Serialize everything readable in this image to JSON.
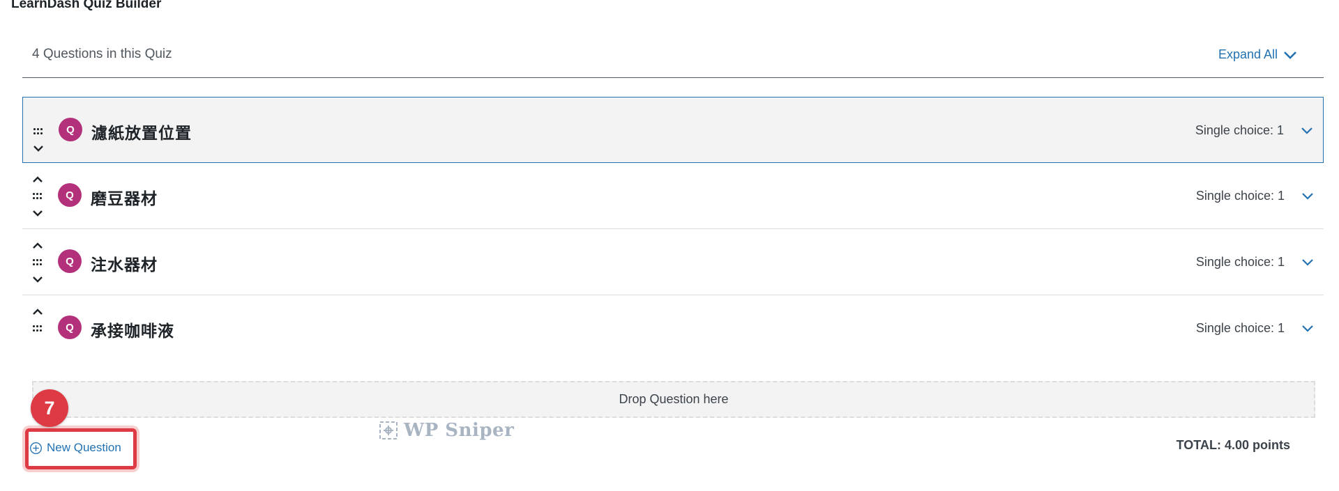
{
  "page_title": "LearnDash Quiz Builder",
  "header": {
    "question_count": "4 Questions in this Quiz",
    "expand_all_label": "Expand All"
  },
  "questions": [
    {
      "badge": "Q",
      "title": "濾紙放置位置",
      "type": "Single choice: 1"
    },
    {
      "badge": "Q",
      "title": "磨豆器材",
      "type": "Single choice: 1"
    },
    {
      "badge": "Q",
      "title": "注水器材",
      "type": "Single choice: 1"
    },
    {
      "badge": "Q",
      "title": "承接咖啡液",
      "type": "Single choice: 1"
    }
  ],
  "dropzone_label": "Drop Question here",
  "step_badge": "7",
  "new_question_label": "New Question",
  "watermark_text": "WP Sniper",
  "total_label": "TOTAL: 4.00 points",
  "colors": {
    "accent": "#2271b1",
    "question_badge": "#b2317a",
    "highlight": "#dd3a44"
  },
  "icons": {
    "expand": "chevron-down-icon",
    "move_up": "chevron-up-icon",
    "move_down": "chevron-down-icon",
    "drag": "drag-handle-icon",
    "add": "plus-circle-icon"
  }
}
